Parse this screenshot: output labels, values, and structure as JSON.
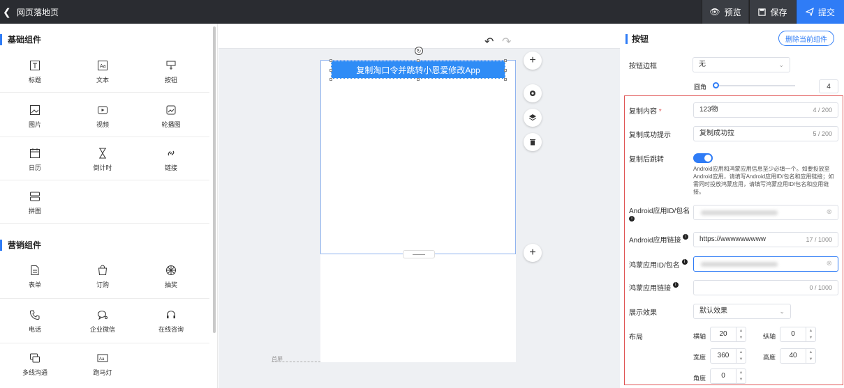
{
  "topbar": {
    "title": "网页落地页",
    "preview_label": "预览",
    "save_label": "保存",
    "submit_label": "提交"
  },
  "left": {
    "basic_title": "基础组件",
    "basic_items": [
      "标题",
      "文本",
      "按钮",
      "图片",
      "视频",
      "轮播图",
      "日历",
      "倒计时",
      "链接",
      "拼图"
    ],
    "marketing_title": "营销组件",
    "marketing_items": [
      "表单",
      "订购",
      "抽奖",
      "电话",
      "企业微信",
      "在线咨询",
      "多线沟通",
      "跑马灯"
    ]
  },
  "canvas": {
    "button_text": "复制淘口令并跳转小恩爱修改App",
    "first_screen_label": "首屏"
  },
  "right": {
    "title": "按钮",
    "delete_label": "删除当前组件",
    "border_label": "按钮边框",
    "border_value": "无",
    "radius_label": "圆角",
    "radius_value": "4",
    "copy_content_label": "复制内容",
    "copy_content_value": "123物",
    "copy_content_count": "4 / 200",
    "copy_success_label": "复制成功提示",
    "copy_success_value": "复制成功拉",
    "copy_success_count": "5 / 200",
    "jump_label": "复制后跳转",
    "help_text": "Android应用和鸿蒙应用信息至少必填一个。如要投放至Android应用，请填写Android应用ID/包名和应用链接；如需同时投放鸿蒙应用，请填写鸿蒙应用ID/包名和应用链接。",
    "android_id_label": "Android应用ID/包名",
    "android_link_label": "Android应用链接",
    "android_link_value": "https://wwwwwwwww",
    "android_link_count": "17 / 1000",
    "harmony_id_label": "鸿蒙应用ID/包名",
    "harmony_link_label": "鸿蒙应用链接",
    "harmony_link_count": "0 / 1000",
    "effect_label": "展示效果",
    "effect_value": "默认效果",
    "layout_label": "布局",
    "x_label": "横轴",
    "x_value": "20",
    "y_label": "纵轴",
    "y_value": "0",
    "w_label": "宽度",
    "w_value": "360",
    "h_label": "高度",
    "h_value": "40",
    "angle_label": "角度",
    "angle_value": "0"
  },
  "colors": {
    "accent": "#2f7cf6",
    "topbar": "#2a2c31",
    "highlight_border": "#e05555"
  }
}
